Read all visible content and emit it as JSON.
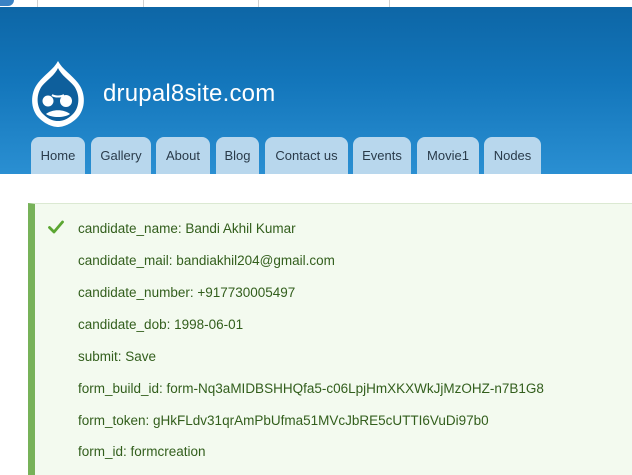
{
  "site": {
    "name": "drupal8site.com"
  },
  "nav": {
    "tabs": [
      {
        "label": "Home"
      },
      {
        "label": "Gallery"
      },
      {
        "label": "About"
      },
      {
        "label": "Blog"
      },
      {
        "label": "Contact us"
      },
      {
        "label": "Events"
      },
      {
        "label": "Movie1"
      },
      {
        "label": "Nodes"
      }
    ]
  },
  "status": {
    "icon": "checkmark-icon",
    "lines": [
      "candidate_name: Bandi Akhil Kumar",
      "candidate_mail: bandiakhil204@gmail.com",
      "candidate_number: +917730005497",
      "candidate_dob: 1998-06-01",
      "submit: Save",
      "form_build_id: form-Nq3aMIDBSHHQfa5-c06LpjHmXKXWkJjMzOHZ-n7B1G8",
      "form_token: gHkFLdv31qrAmPbUfma51MVcJbRE5cUTTI6VuDi97b0",
      "form_id: formcreation"
    ]
  },
  "colors": {
    "header": "#1376bb",
    "tab": "#b8d7ed",
    "status_border": "#77b259",
    "status_bg": "#f3faef",
    "status_text": "#325e1c"
  }
}
